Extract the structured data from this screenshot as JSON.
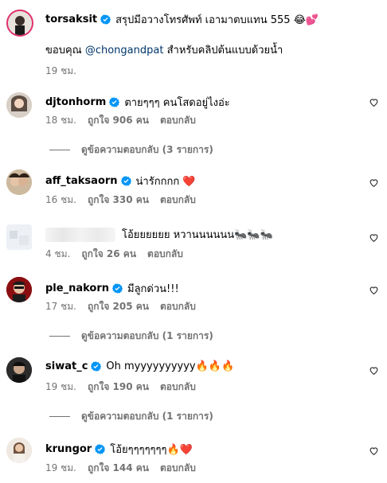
{
  "post": {
    "username": "torsaksit",
    "caption": "สรุปมีอวางโทรศัพท์ เอามาตบแทน 555 😂💕",
    "line2_prefix": "ขอบคุณ ",
    "line2_mention": "@chongandpat",
    "line2_suffix": " สำหรับคลิปต้นแบบด้วยน้ำ",
    "time": "19 ชม."
  },
  "comments": [
    {
      "username": "djtonhorm",
      "text": "ตายๆๆๆ คนโสดอยู่ไงอ่ะ",
      "time": "18 ชม.",
      "likes": "ถูกใจ 906 คน",
      "reply": "ตอบกลับ",
      "view_replies": "ดูข้อความตอบกลับ (3 รายการ)"
    },
    {
      "username": "aff_taksaorn",
      "text": "น่ารักกกก ❤️",
      "time": "16 ชม.",
      "likes": "ถูกใจ 330 คน",
      "reply": "ตอบกลับ"
    },
    {
      "username": "",
      "text": "โอ้ยยยยยย หวานนนนนน🐜🐜🐜",
      "time": "4 ชม.",
      "likes": "ถูกใจ 26 คน",
      "reply": "ตอบกลับ"
    },
    {
      "username": "ple_nakorn",
      "text": "มีลูกด่วน!!!",
      "time": "17 ชม.",
      "likes": "ถูกใจ 205 คน",
      "reply": "ตอบกลับ",
      "view_replies": "ดูข้อความตอบกลับ (1 รายการ)"
    },
    {
      "username": "siwat_c",
      "text": "Oh myyyyyyyyyy🔥🔥🔥",
      "time": "19 ชม.",
      "likes": "ถูกใจ 190 คน",
      "reply": "ตอบกลับ",
      "view_replies": "ดูข้อความตอบกลับ (1 รายการ)"
    },
    {
      "username": "krungor",
      "text": "โอ้ยๆๆๆๆๆๆๆ🔥❤️",
      "time": "19 ชม.",
      "likes": "ถูกใจ 144 คน",
      "reply": "ตอบกลับ"
    }
  ],
  "colors": {
    "verified": "#0095f6",
    "secondary": "#737373",
    "mention": "#00376b"
  },
  "icons": {
    "verified": "verified-badge-icon",
    "like": "heart-icon"
  }
}
